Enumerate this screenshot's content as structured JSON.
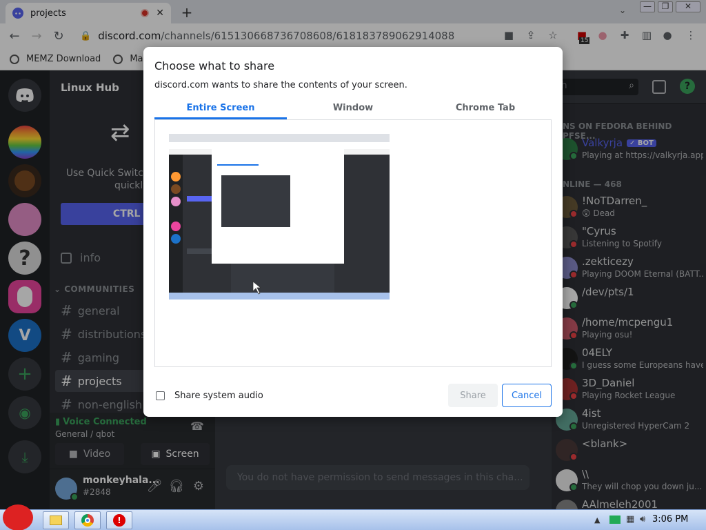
{
  "browser": {
    "tab_title": "projects",
    "url_host": "discord.com",
    "url_path": "/channels/615130668736708608/618183789062914088",
    "extension_badge": "15",
    "bookmarks": [
      "MEMZ Download",
      "Malw"
    ]
  },
  "server": {
    "name": "Linux Hub",
    "quick_switcher_text": "Use Quick Switcher Discord quickly.",
    "quick_switcher_button": "CTRL +",
    "info_channel": "info",
    "category": "COMMUNITIES",
    "channels": [
      "general",
      "distributions",
      "gaming",
      "projects",
      "non-english"
    ],
    "active_channel": "projects"
  },
  "voice": {
    "status": "Voice Connected",
    "location": "General / qbot",
    "video_label": "Video",
    "screen_label": "Screen"
  },
  "user": {
    "name": "monkeyhala...",
    "tag": "#2848"
  },
  "chat_placeholder": "You do not have permission to send messages in this cha...",
  "members": {
    "search_placeholder": "ch",
    "group1": "NS ON FEDORA BEHIND PFSE...",
    "group2": "NLINE — 468",
    "list": [
      {
        "name": "Valkyrja",
        "badge": "✓ BOT",
        "activity": "Playing at https://valkyrja.app"
      },
      {
        "name": "!NoTDarren_",
        "activity": "😲 Dead"
      },
      {
        "name": "\"Cyrus",
        "activity": "Listening to Spotify"
      },
      {
        "name": ".zekticezy",
        "activity": "Playing DOOM Eternal (BATT..."
      },
      {
        "name": "/dev/pts/1",
        "activity": ""
      },
      {
        "name": "/home/mcpengu1",
        "activity": "Playing osu!"
      },
      {
        "name": "04ELY",
        "activity": "I guess some Europeans have ..."
      },
      {
        "name": "3D_Daniel",
        "activity": "Playing Rocket League"
      },
      {
        "name": "4ist",
        "activity": "Unregistered HyperCam 2"
      },
      {
        "name": "<blank>",
        "activity": ""
      },
      {
        "name": "\\\\",
        "activity": "They will chop you down ju..."
      },
      {
        "name": "AAlmeleh2001",
        "activity": ""
      }
    ]
  },
  "dialog": {
    "title": "Choose what to share",
    "subtitle": "discord.com wants to share the contents of your screen.",
    "tabs": [
      "Entire Screen",
      "Window",
      "Chrome Tab"
    ],
    "selected_tab": "Entire Screen",
    "audio_label": "Share system audio",
    "share_button": "Share",
    "cancel_button": "Cancel"
  },
  "taskbar": {
    "clock": "3:06 PM"
  },
  "colors": {
    "accent": "#1a73e8",
    "discord_blurple": "#5865f2",
    "online": "#3ba55d",
    "dnd": "#ed4245"
  }
}
